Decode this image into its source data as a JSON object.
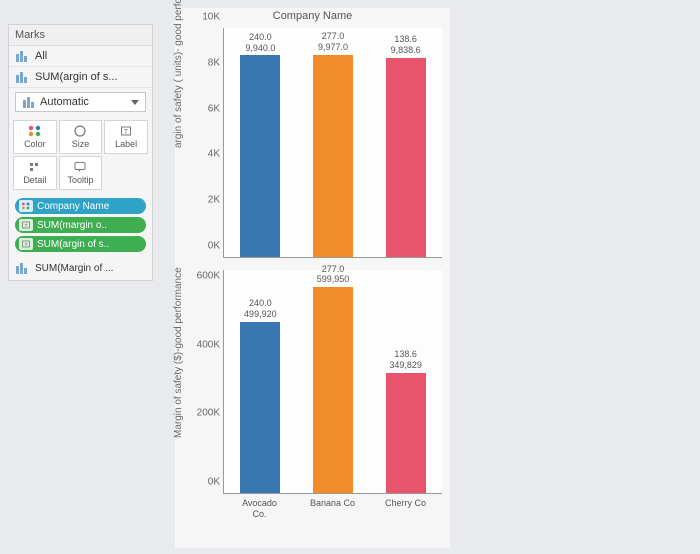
{
  "marks": {
    "header": "Marks",
    "rows": [
      {
        "icon": "bars-icon",
        "label": "All"
      },
      {
        "icon": "bars-icon",
        "label": "SUM(argin of s..."
      }
    ],
    "dropdown": {
      "selected": "Automatic"
    },
    "encode": {
      "color": "Color",
      "size": "Size",
      "label": "Label",
      "detail": "Detail",
      "tooltip": "Tooltip"
    },
    "pills": [
      {
        "label": "Company Name",
        "color": "blue",
        "glyph": "color"
      },
      {
        "label": "SUM(margin o..",
        "color": "green",
        "glyph": "label"
      },
      {
        "label": "SUM(argin of s..",
        "color": "green",
        "glyph": "label"
      }
    ],
    "below": {
      "label": "SUM(Margin of ..."
    }
  },
  "chart_data": [
    {
      "type": "bar",
      "categories": [
        "Avocado Co.",
        "Banana Co",
        "Cherry Co"
      ],
      "values": [
        9940.0,
        9977.0,
        9838.6
      ],
      "secondary_labels": [
        "240.0",
        "277.0",
        "138.6"
      ],
      "value_labels": [
        "9,940.0",
        "9,977.0",
        "9,838.6"
      ],
      "ylim": [
        0,
        10000
      ],
      "yticks": [
        "0K",
        "2K",
        "4K",
        "6K",
        "8K",
        "10K"
      ],
      "ylabel": "argin of safety ( units)- good performance",
      "xlabel": "Company Name",
      "colors": [
        "#3977b3",
        "#f28c2a",
        "#e8546b"
      ]
    },
    {
      "type": "bar",
      "categories": [
        "Avocado Co.",
        "Banana Co",
        "Cherry Co"
      ],
      "values": [
        499920,
        599950,
        349829
      ],
      "secondary_labels": [
        "240.0",
        "277.0",
        "138.6"
      ],
      "value_labels": [
        "499,920",
        "599,950",
        "349,829"
      ],
      "ylim": [
        0,
        650000
      ],
      "yticks": [
        "0K",
        "200K",
        "400K",
        "600K"
      ],
      "ylabel": "Margin of safety ($)-good performance",
      "colors": [
        "#3977b3",
        "#f28c2a",
        "#e8546b"
      ]
    }
  ]
}
